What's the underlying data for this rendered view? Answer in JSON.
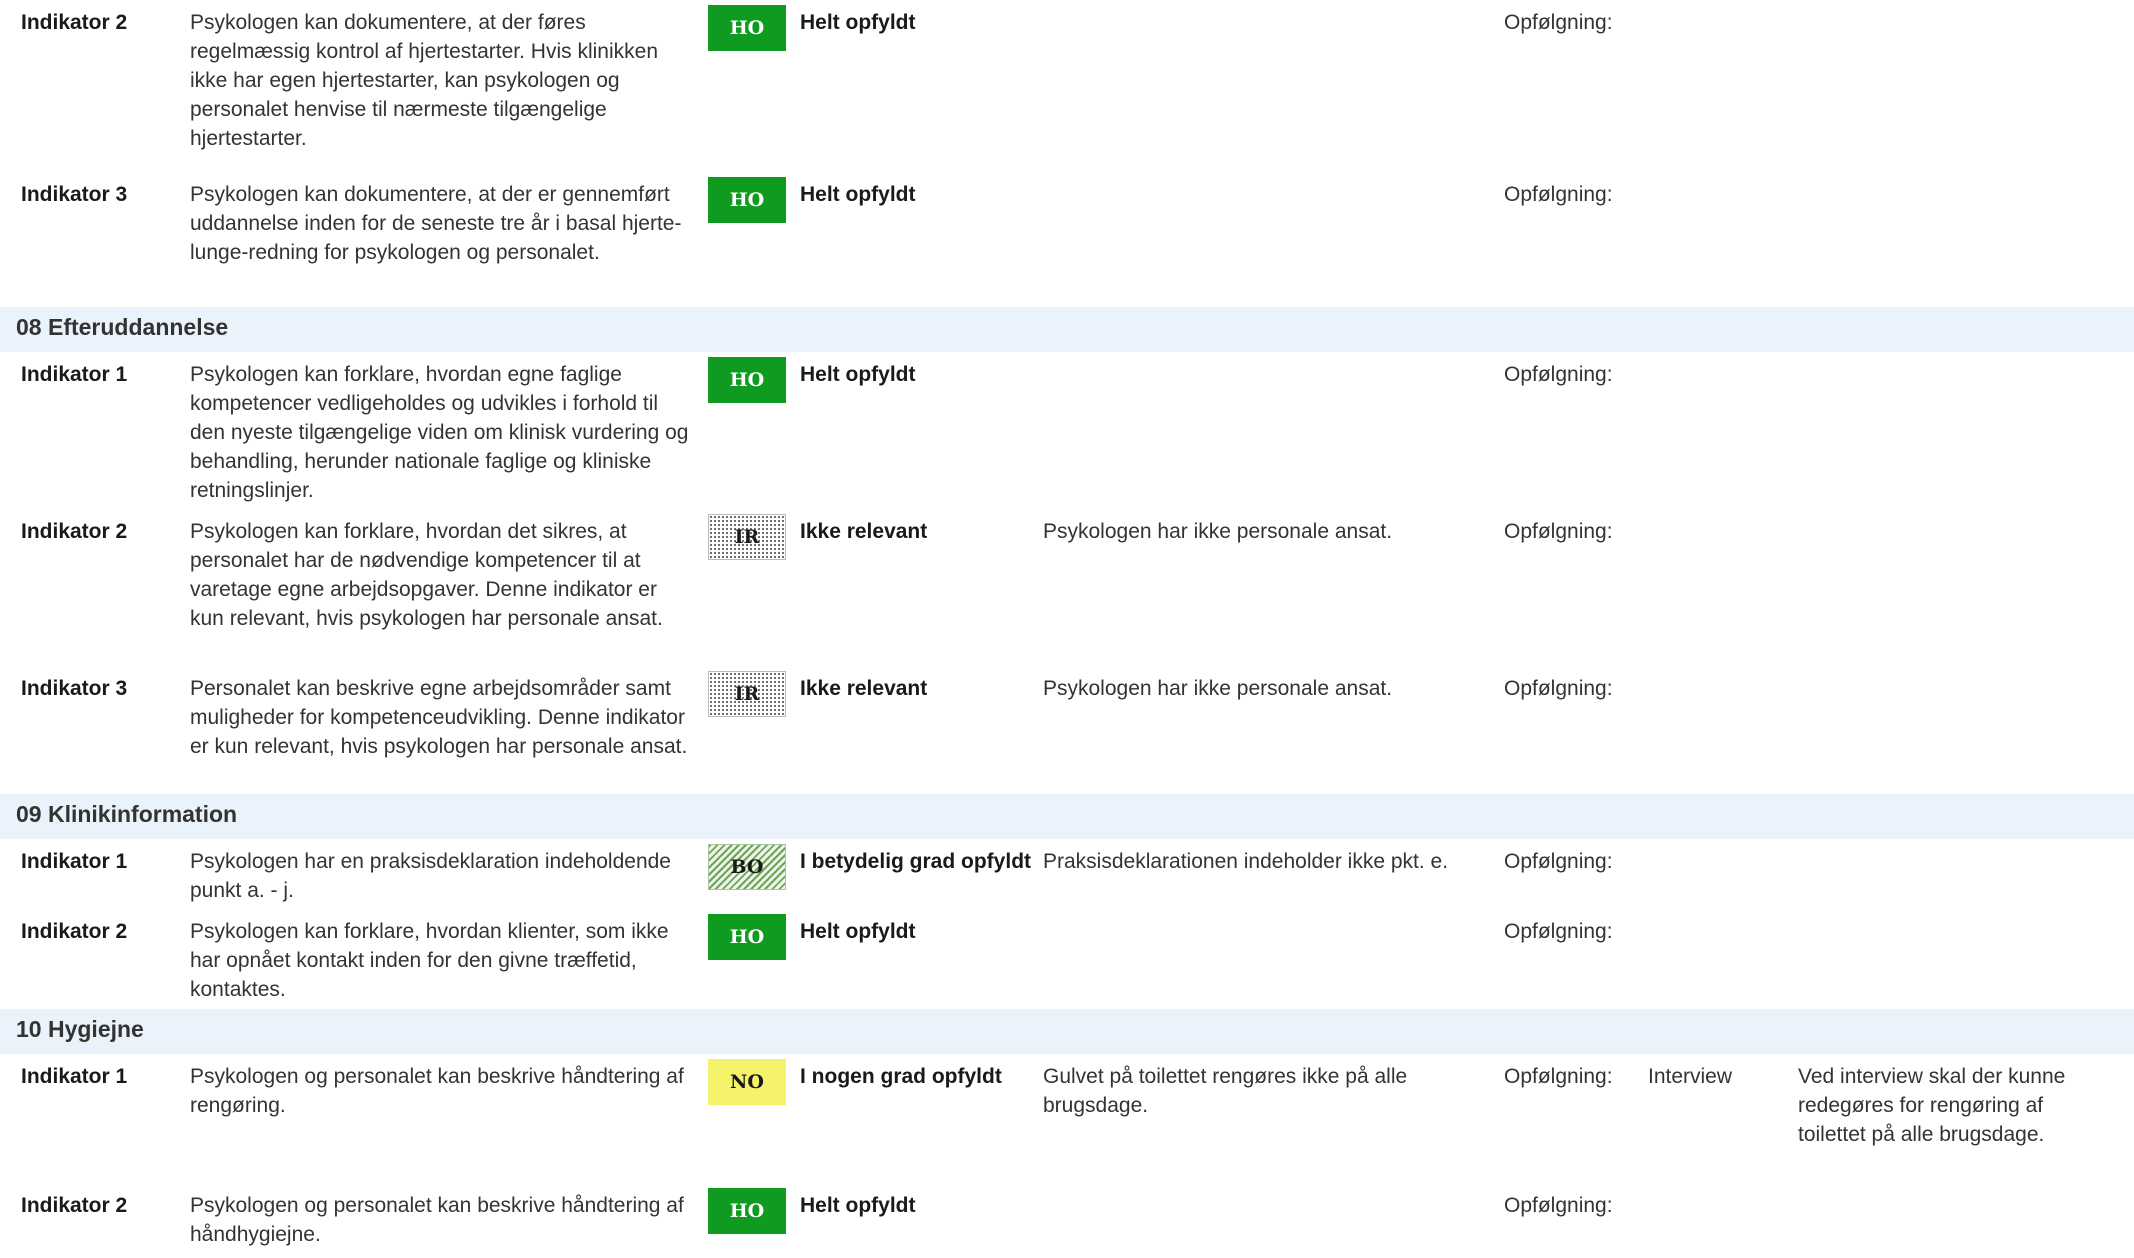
{
  "blocks": [
    {
      "type": "row",
      "height": 172,
      "indicator": "Indikator  2",
      "description": "Psykologen kan dokumentere, at der føres regelmæssig kontrol af hjertestarter.   Hvis klinikken ikke har egen hjertestarter, kan psykologen og personalet henvise til nærmeste tilgængelige hjertestarter.",
      "badge": "HO",
      "status": "Helt opfyldt",
      "comment": "",
      "followup": "Opfølgning:",
      "followup_method": "",
      "followup_note": ""
    },
    {
      "type": "row",
      "height": 135,
      "indicator": "Indikator  3",
      "description": "Psykologen kan dokumentere, at der er gennemført uddannelse inden for de seneste tre år i basal hjerte-lunge-redning for psykologen og personalet.",
      "badge": "HO",
      "status": "Helt opfyldt",
      "comment": "",
      "followup": "Opfølgning:",
      "followup_method": "",
      "followup_note": ""
    },
    {
      "type": "section",
      "title": "08 Efteruddannelse"
    },
    {
      "type": "row",
      "height": 157,
      "indicator": "Indikator  1",
      "description": "Psykologen kan forklare, hvordan egne faglige kompetencer vedligeholdes og udvikles i forhold til den nyeste tilgængelige viden om klinisk vurdering og behandling, herunder nationale faglige og kliniske retningslinjer.",
      "badge": "HO",
      "status": "Helt opfyldt",
      "comment": "",
      "followup": "Opfølgning:",
      "followup_method": "",
      "followup_note": ""
    },
    {
      "type": "row",
      "height": 157,
      "indicator": "Indikator  2",
      "description": "Psykologen kan forklare, hvordan det sikres, at personalet har de nødvendige kompetencer til at varetage egne arbejdsopgaver.   Denne indikator er kun relevant, hvis psykologen har personale ansat.",
      "badge": "IR",
      "status": "Ikke relevant",
      "comment": "Psykologen har ikke personale ansat.",
      "followup": "Opfølgning:",
      "followup_method": "",
      "followup_note": ""
    },
    {
      "type": "row",
      "height": 128,
      "indicator": "Indikator  3",
      "description": "Personalet kan beskrive egne arbejdsområder samt muligheder for kompetenceudvikling.   Denne indikator er kun relevant, hvis psykologen har personale ansat.",
      "badge": "IR",
      "status": "Ikke relevant",
      "comment": "Psykologen har ikke personale ansat.",
      "followup": "Opfølgning:",
      "followup_method": "",
      "followup_note": ""
    },
    {
      "type": "section",
      "title": "09 Klinikinformation"
    },
    {
      "type": "row",
      "height": 70,
      "indicator": "Indikator  1",
      "description": "Psykologen har en praksisdeklaration indeholdende punkt a. - j.",
      "badge": "BO",
      "status": "I betydelig grad opfyldt",
      "comment": "Praksisdeklarationen indeholder ikke pkt. e.",
      "followup": "Opfølgning:",
      "followup_method": "",
      "followup_note": ""
    },
    {
      "type": "row",
      "height": 100,
      "indicator": "Indikator  2",
      "description": "Psykologen kan forklare, hvordan klienter, som ikke har opnået kontakt inden for den givne træffetid, kontaktes.",
      "badge": "HO",
      "status": "Helt opfyldt",
      "comment": "",
      "followup": "Opfølgning:",
      "followup_method": "",
      "followup_note": ""
    },
    {
      "type": "section",
      "title": "10 Hygiejne"
    },
    {
      "type": "row",
      "height": 129,
      "indicator": "Indikator  1",
      "description": "Psykologen og personalet kan beskrive håndtering af rengøring.",
      "badge": "NO",
      "status": "I nogen grad opfyldt",
      "comment": "Gulvet på toilettet rengøres ikke på alle brugsdage.",
      "followup": "Opfølgning:",
      "followup_method": "Interview",
      "followup_note": "Ved interview skal der kunne redegøres for rengøring af toilettet på alle brugsdage."
    },
    {
      "type": "row",
      "height": 75,
      "indicator": "Indikator  2",
      "description": "Psykologen og personalet kan beskrive håndtering af håndhygiejne.",
      "badge": "HO",
      "status": "Helt opfyldt",
      "comment": "",
      "followup": "Opfølgning:",
      "followup_method": "",
      "followup_note": ""
    }
  ]
}
